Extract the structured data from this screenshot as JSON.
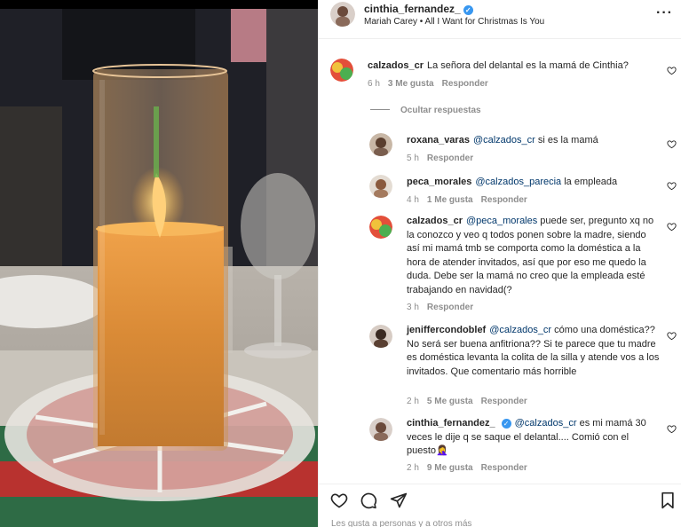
{
  "post": {
    "username": "cinthia_fernandez_",
    "audio": "Mariah Carey • All I Want for Christmas Is You",
    "more_icon": "ellipsis-icon"
  },
  "comments": [
    {
      "user": "calzados_cr",
      "text": "La señora del delantal es la mamá de Cinthia?",
      "time": "6 h",
      "likes": "3 Me gusta",
      "reply": "Responder"
    }
  ],
  "hide_replies": "Ocultar respuestas",
  "replies": [
    {
      "user": "roxana_varas",
      "mention": "@calzados_cr",
      "text": " si es la mamá",
      "time": "5 h",
      "reply": "Responder"
    },
    {
      "user": "peca_morales",
      "mention": "@calzados_parecia",
      "text": " la empleada",
      "time": "4 h",
      "likes": "1 Me gusta",
      "reply": "Responder"
    },
    {
      "user": "calzados_cr",
      "mention": "@peca_morales",
      "text": " puede ser, pregunto xq no la conozco y veo q todos ponen sobre la madre, siendo así mi mamá tmb se comporta como la doméstica a la hora de atender invitados, así que por eso me quedo la duda. Debe ser la mamá no creo que la empleada esté trabajando en navidad(?",
      "time": "3 h",
      "reply": "Responder"
    },
    {
      "user": "jeniffercondoblef",
      "mention": "@calzados_cr",
      "text": " cómo una doméstica?? No será ser buena anfitriona?? Si te parece que tu madre es doméstica levanta la colita de la silla y atende vos a los invitados. Que comentario más horrible",
      "time": "2 h",
      "likes": "5 Me gusta",
      "reply": "Responder"
    },
    {
      "user": "cinthia_fernandez_",
      "mention": "@calzados_cr",
      "text": " es mi mamá 30 veces le dije q se saque el delantal.... Comió con el puesto🤦‍♀️",
      "time": "2 h",
      "likes": "9 Me gusta",
      "reply": "Responder"
    }
  ],
  "footer": {
    "likes_text": "Les gusta a personas y a otros más"
  },
  "colors": {
    "mention": "#00376b",
    "meta": "#8e8e8e",
    "verified": "#3897f0"
  }
}
